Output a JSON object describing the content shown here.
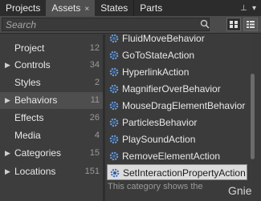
{
  "tabs": [
    {
      "label": "Projects"
    },
    {
      "label": "Assets",
      "close": "×"
    },
    {
      "label": "States"
    },
    {
      "label": "Parts"
    }
  ],
  "tab_icons": {
    "pin": "⊥",
    "menu": "▾"
  },
  "search": {
    "placeholder": "Search"
  },
  "categories": [
    {
      "name": "Project",
      "count": "12",
      "arrow": ""
    },
    {
      "name": "Controls",
      "count": "34",
      "arrow": "▶"
    },
    {
      "name": "Styles",
      "count": "2",
      "arrow": ""
    },
    {
      "name": "Behaviors",
      "count": "11",
      "arrow": "▶"
    },
    {
      "name": "Effects",
      "count": "26",
      "arrow": ""
    },
    {
      "name": "Media",
      "count": "4",
      "arrow": ""
    },
    {
      "name": "Categories",
      "count": "15",
      "arrow": "▶"
    },
    {
      "name": "Locations",
      "count": "151",
      "arrow": "▶"
    }
  ],
  "selected_category": "Behaviors",
  "items": [
    "FluidMoveBehavior",
    "GoToStateAction",
    "HyperlinkAction",
    "MagnifierOverBehavior",
    "MouseDragElementBehavior",
    "ParticlesBehavior",
    "PlaySoundAction",
    "RemoveElementAction",
    "SetInteractionPropertyAction"
  ],
  "selected_item": "SetInteractionPropertyAction",
  "description": "This category shows the",
  "watermark": "Gnie",
  "colors": {
    "accent_gear": "#5a8fd0",
    "selected_bg": "#dcdcdc"
  }
}
